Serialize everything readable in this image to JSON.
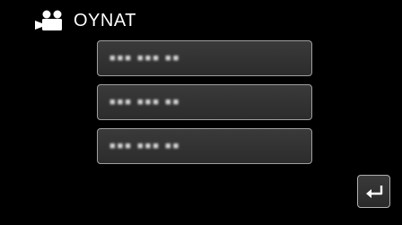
{
  "header": {
    "icon": "video-camera-icon",
    "title": "OYNAT"
  },
  "menu": {
    "items": [
      {
        "label": "■■■ ■■■ ■■"
      },
      {
        "label": "■■■ ■■■ ■■"
      },
      {
        "label": "■■■ ■■■ ■■"
      }
    ]
  },
  "back_button": {
    "icon": "return-arrow-icon"
  },
  "colors": {
    "background": "#000000",
    "button_fill": "#333333",
    "button_border": "#a0a0a0",
    "text": "#ffffff"
  }
}
